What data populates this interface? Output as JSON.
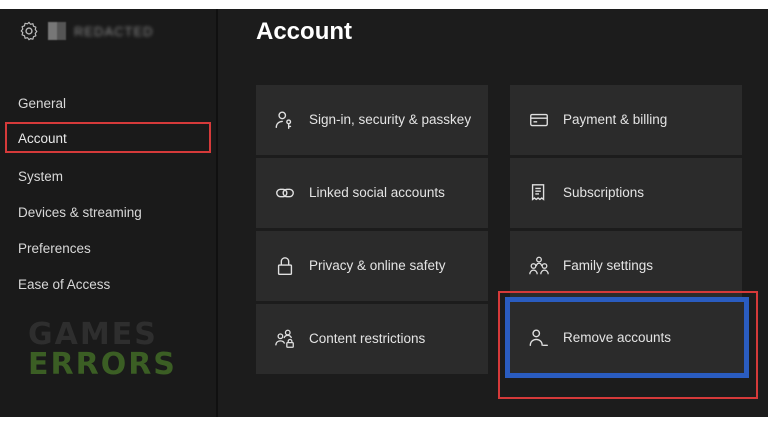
{
  "page": {
    "title": "Account"
  },
  "sidebar": {
    "gamertag": "REDACTED",
    "items": [
      {
        "label": "General"
      },
      {
        "label": "Account"
      },
      {
        "label": "System"
      },
      {
        "label": "Devices & streaming"
      },
      {
        "label": "Preferences"
      },
      {
        "label": "Ease of Access"
      }
    ],
    "selected": "Account"
  },
  "tiles": [
    {
      "label": "Sign-in, security & passkey",
      "icon": "person-key-icon"
    },
    {
      "label": "Payment & billing",
      "icon": "credit-card-icon"
    },
    {
      "label": "Linked social accounts",
      "icon": "link-icon"
    },
    {
      "label": "Subscriptions",
      "icon": "receipt-icon"
    },
    {
      "label": "Privacy & online safety",
      "icon": "lock-icon"
    },
    {
      "label": "Family settings",
      "icon": "family-icon"
    },
    {
      "label": "Content restrictions",
      "icon": "people-lock-icon"
    },
    {
      "label": "Remove accounts",
      "icon": "person-remove-icon"
    }
  ],
  "focused_tile": "Remove accounts",
  "watermark": {
    "line1": "GAMES",
    "line2": "ERRORS"
  },
  "colors": {
    "highlight_red": "#d53a3a",
    "focus_blue": "#2a5cc0",
    "watermark_green": "#3b5e24"
  }
}
